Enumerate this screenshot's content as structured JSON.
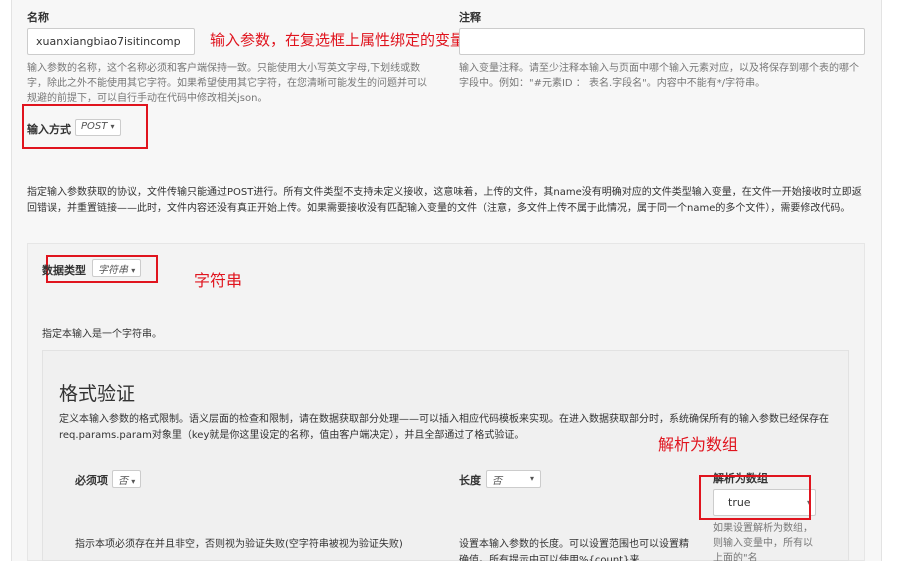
{
  "name_field": {
    "label": "名称",
    "value": "xuanxiangbiao7isitincomp",
    "help": "输入参数的名称，这个名称必须和客户端保持一致。只能使用大小写英文字母,下划线或数字，除此之外不能使用其它字符。如果希望使用其它字符，在您清晰可能发生的问题并可以规避的前提下，可以自行手动在代码中修改相关json。",
    "annotation": "输入参数，在复选框上属性绑定的变量名"
  },
  "comment_field": {
    "label": "注释",
    "value": "",
    "help": "输入变量注释。请至少注释本输入与页面中哪个输入元素对应，以及将保存到哪个表的哪个字段中。例如：\"#元素ID ： 表名.字段名\"。内容中不能有*/字符串。"
  },
  "input_method": {
    "label": "输入方式",
    "selected": "POST",
    "description": "指定输入参数获取的协议，文件传输只能通过POST进行。所有文件类型不支持未定义接收，这意味着，上传的文件，其name没有明确对应的文件类型输入变量，在文件一开始接收时立即返回错误，并重置链接——此时，文件内容还没有真正开始上传。如果需要接收没有匹配输入变量的文件（注意，多文件上传不属于此情况，属于同一个name的多个文件），需要修改代码。"
  },
  "data_type": {
    "label": "数据类型",
    "selected": "字符串",
    "annotation": "字符串",
    "description": "指定本输入是一个字符串。"
  },
  "format_validation": {
    "title": "格式验证",
    "description": "定义本输入参数的格式限制。语义层面的检查和限制，请在数据获取部分处理——可以插入相应代码模板来实现。在进入数据获取部分时，系统确保所有的输入参数已经保存在req.params.param对象里（key就是你这里设定的名称，值由客户端决定），并且全部通过了格式验证。",
    "annotation": "解析为数组",
    "required": {
      "label": "必须项",
      "selected": "否",
      "help": "指示本项必须存在并且非空，否则视为验证失败(空字符串被视为验证失败)"
    },
    "length": {
      "label": "长度",
      "selected": "否",
      "help": "设置本输入参数的长度。可以设置范围也可以设置精确值。所有提示中可以使用%{count}来"
    },
    "parse_array": {
      "label": "解析为数组",
      "selected": "true",
      "help": "如果设置解析为数组，则输入变量中，所有以上面的\"名"
    }
  },
  "colors": {
    "annotation": "#e0141e",
    "panel": "#f7f7f7"
  }
}
